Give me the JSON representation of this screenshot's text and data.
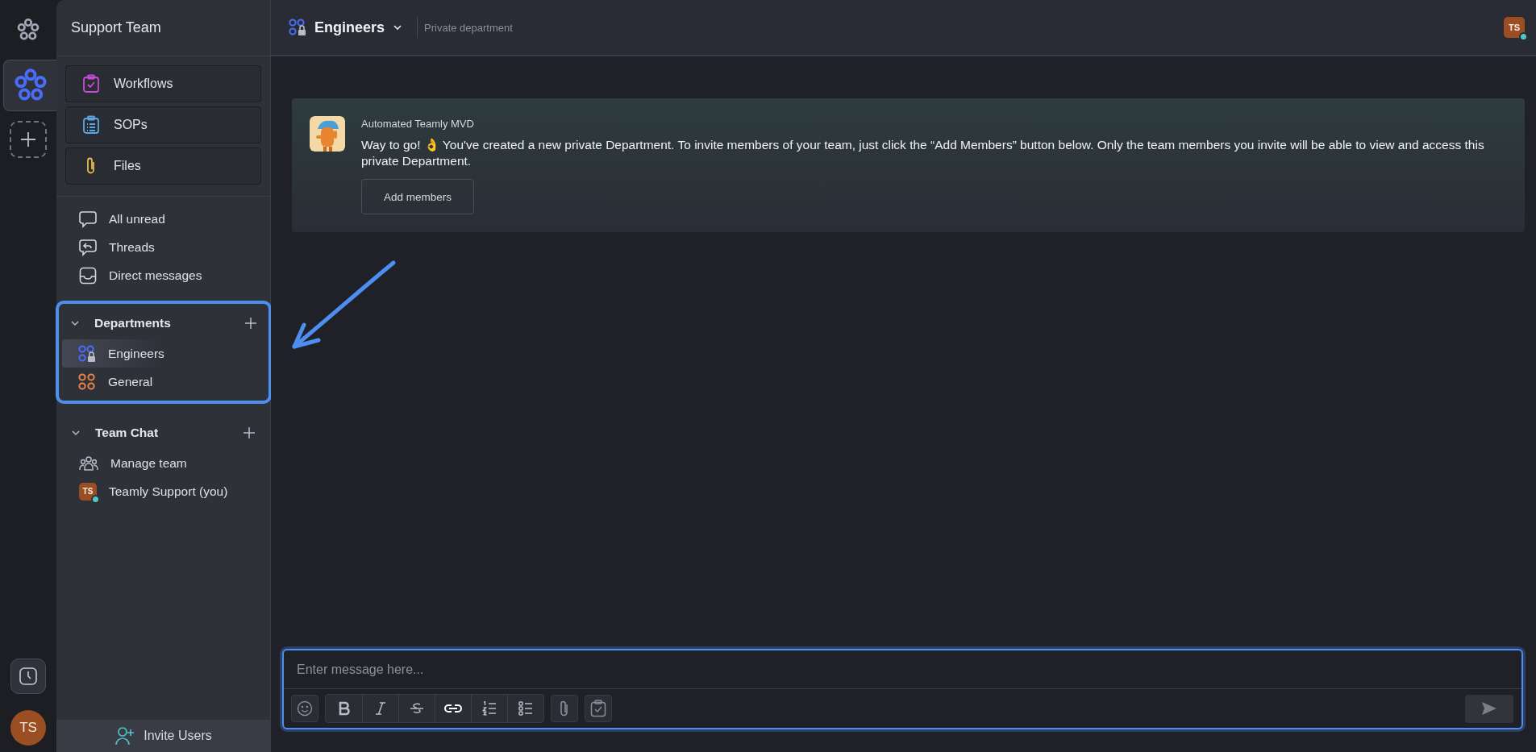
{
  "rail": {
    "avatar": "TS"
  },
  "sidebar": {
    "title": "Support Team",
    "tools": [
      {
        "label": "Workflows",
        "kind": "workflows"
      },
      {
        "label": "SOPs",
        "kind": "sops"
      },
      {
        "label": "Files",
        "kind": "files"
      }
    ],
    "views": [
      {
        "label": "All unread",
        "kind": "unread"
      },
      {
        "label": "Threads",
        "kind": "threads"
      },
      {
        "label": "Direct messages",
        "kind": "direct"
      }
    ],
    "sections": [
      {
        "title": "Departments",
        "expanded": true,
        "highlighted": true,
        "items": [
          {
            "label": "Engineers",
            "kind": "private",
            "selected": true
          },
          {
            "label": "General",
            "kind": "public",
            "selected": false
          }
        ]
      },
      {
        "title": "Team Chat",
        "expanded": true,
        "highlighted": false,
        "items": [
          {
            "label": "Manage team",
            "kind": "team",
            "selected": false
          },
          {
            "label": "Teamly Support (you)",
            "kind": "user",
            "avatar": "TS",
            "online": true,
            "selected": false
          }
        ]
      }
    ],
    "invite": "Invite Users"
  },
  "header": {
    "title": "Engineers",
    "subtitle": "Private department",
    "avatar": "TS",
    "online": true
  },
  "message": {
    "sender": "Automated Teamly MVD",
    "text": "Way to go! 👌 You've created a new private Department. To invite members of your team, just click the “Add Members” button below. Only the team members you invite will be able to view and access this private Department.",
    "button": "Add members"
  },
  "composer": {
    "placeholder": "Enter message here..."
  }
}
